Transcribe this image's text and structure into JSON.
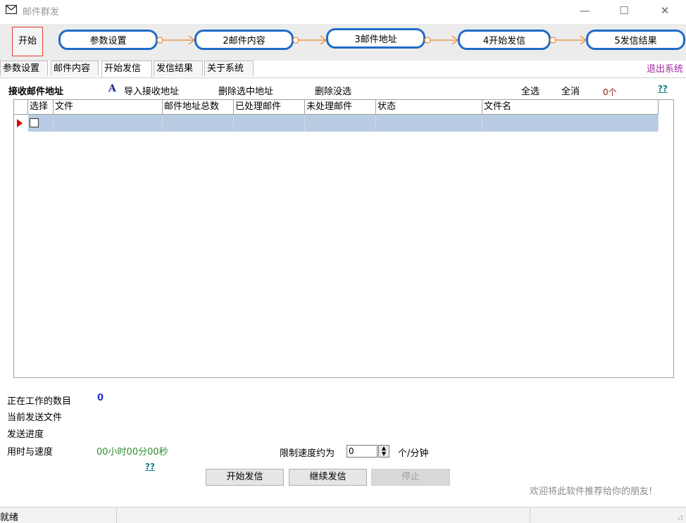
{
  "window": {
    "title": "邮件群发",
    "controls": [
      "—",
      "☐",
      "✕"
    ]
  },
  "workflow": {
    "start": "开始",
    "steps": [
      "参数设置",
      "2邮件内容",
      "3邮件地址",
      "4开始发信",
      "5发信结果"
    ],
    "colors": {
      "step_border": "#1e6cc7",
      "arrow": "#e8892e",
      "start_border": "#e53935"
    }
  },
  "tabs": [
    "参数设置",
    "邮件内容",
    "开始发信",
    "发信结果",
    "关于系统"
  ],
  "active_tab": "开始发信",
  "exit_label": "退出系统",
  "toolbar": {
    "heading": "接收邮件地址",
    "import_icon": "A",
    "import": "导入接收地址",
    "delete_selected": "删除选中地址",
    "delete_unselected": "删除没选",
    "select_all": "全选",
    "deselect_all": "全消",
    "count": "0个",
    "help": "??"
  },
  "grid": {
    "columns": [
      "选择",
      "文件",
      "邮件地址总数",
      "已处理邮件",
      "未处理邮件",
      "状态",
      "文件名"
    ],
    "rows": [
      {
        "checked": false,
        "cells": [
          "",
          "",
          "",
          "",
          "",
          ""
        ]
      }
    ]
  },
  "status": {
    "working_label": "正在工作的数目",
    "working_value": "0",
    "current_file_label": "当前发送文件",
    "progress_label": "发送进度",
    "time_speed_label": "用时与速度",
    "time_value": "00小时00分00秒",
    "help": "??",
    "limit_label": "限制速度约为",
    "limit_value": "0",
    "limit_unit": "个/分钟"
  },
  "buttons": {
    "start": "开始发信",
    "continue": "继续发信",
    "stop": "停止"
  },
  "recommend": "欢迎将此软件推荐给你的朋友!",
  "statusbar": {
    "text": "就绪"
  }
}
